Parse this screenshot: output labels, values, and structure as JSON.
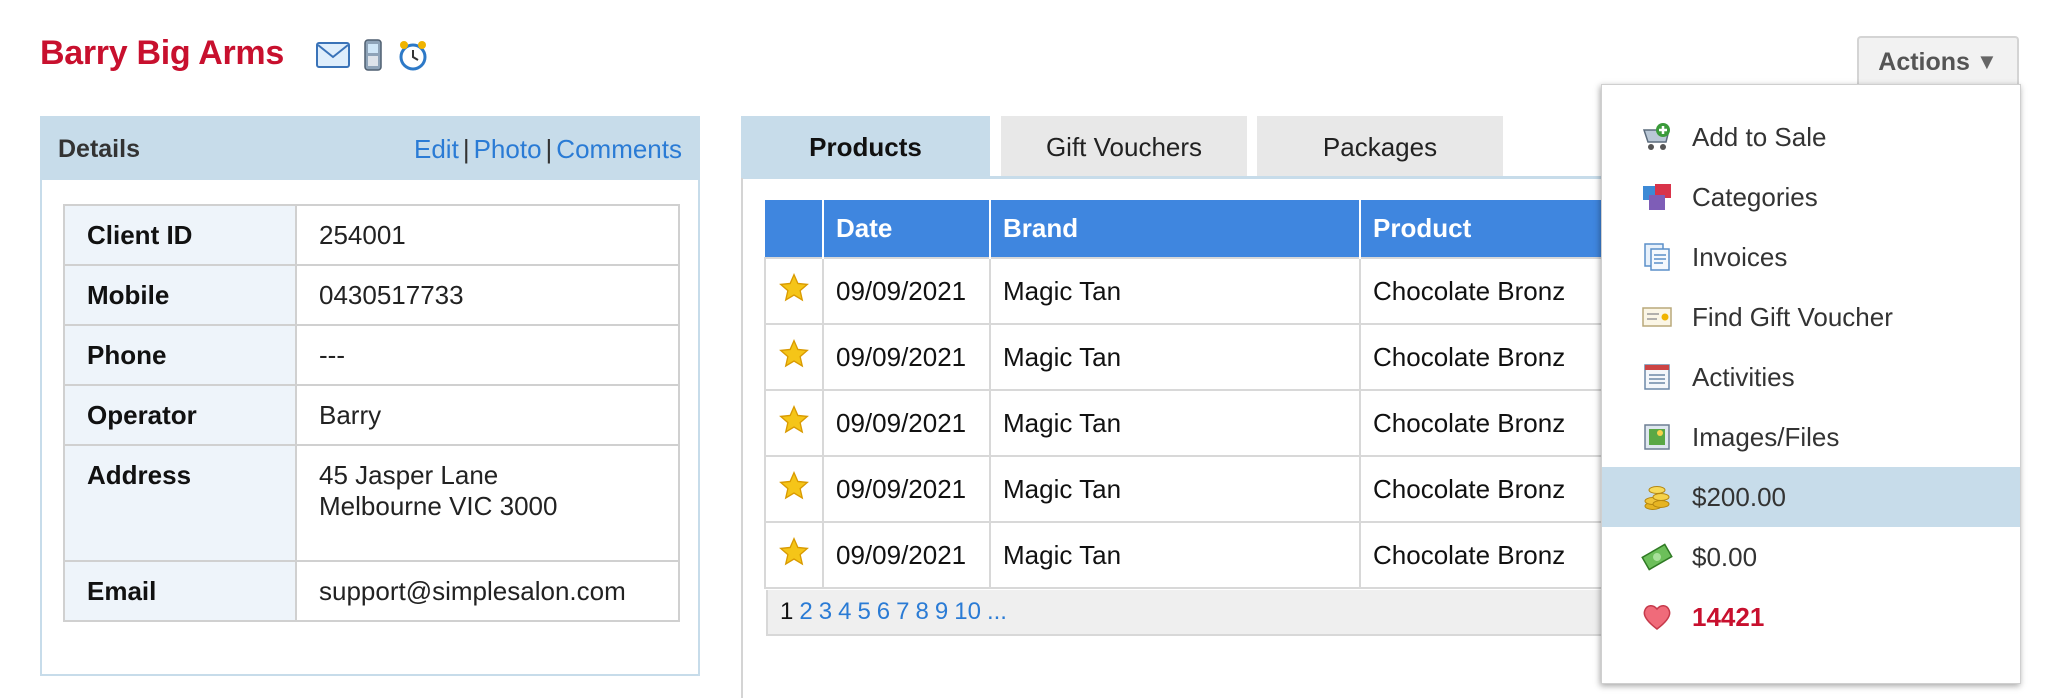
{
  "client": {
    "name": "Barry Big Arms",
    "icons": [
      "email-icon",
      "mobile-phone-icon",
      "alarm-clock-icon"
    ]
  },
  "actions": {
    "label": "Actions",
    "caret": "▼",
    "items": [
      {
        "label": "Add to Sale",
        "icon": "add-to-sale-icon"
      },
      {
        "label": "Categories",
        "icon": "categories-icon"
      },
      {
        "label": "Invoices",
        "icon": "invoices-icon"
      },
      {
        "label": "Find Gift Voucher",
        "icon": "gift-voucher-icon"
      },
      {
        "label": "Activities",
        "icon": "activities-icon"
      },
      {
        "label": "Images/Files",
        "icon": "images-icon"
      },
      {
        "label": "$200.00",
        "icon": "coins-icon",
        "selected": true
      },
      {
        "label": "$0.00",
        "icon": "cash-icon"
      },
      {
        "label": "14421",
        "icon": "heart-icon",
        "color": "#c8102e"
      }
    ]
  },
  "details": {
    "title": "Details",
    "links": [
      "Edit",
      "Photo",
      "Comments"
    ],
    "separator": "|",
    "rows": [
      {
        "label": "Client ID",
        "value": "254001"
      },
      {
        "label": "Mobile",
        "value": "0430517733"
      },
      {
        "label": "Phone",
        "value": "---"
      },
      {
        "label": "Operator",
        "value": "Barry"
      },
      {
        "label": "Address",
        "value": "45 Jasper Lane",
        "value2": "Melbourne VIC 3000"
      },
      {
        "label": "Email",
        "value": "support@simplesalon.com"
      }
    ]
  },
  "tabs": [
    {
      "label": "Products",
      "active": true
    },
    {
      "label": "Gift Vouchers",
      "active": false
    },
    {
      "label": "Packages",
      "active": false
    }
  ],
  "products": {
    "columns": [
      "",
      "Date",
      "Brand",
      "Product"
    ],
    "rows": [
      {
        "date": "09/09/2021",
        "brand": "Magic Tan",
        "product": "Chocolate Bronz"
      },
      {
        "date": "09/09/2021",
        "brand": "Magic Tan",
        "product": "Chocolate Bronz"
      },
      {
        "date": "09/09/2021",
        "brand": "Magic Tan",
        "product": "Chocolate Bronz"
      },
      {
        "date": "09/09/2021",
        "brand": "Magic Tan",
        "product": "Chocolate Bronz"
      },
      {
        "date": "09/09/2021",
        "brand": "Magic Tan",
        "product": "Chocolate Bronz"
      }
    ],
    "pager": {
      "current": "1",
      "pages": [
        "2",
        "3",
        "4",
        "5",
        "6",
        "7",
        "8",
        "9",
        "10",
        "..."
      ]
    }
  },
  "colors": {
    "accent_red": "#c8102e",
    "header_blue": "#3f86df",
    "panel_blue": "#c7dcea",
    "link_blue": "#2a7bd5"
  }
}
